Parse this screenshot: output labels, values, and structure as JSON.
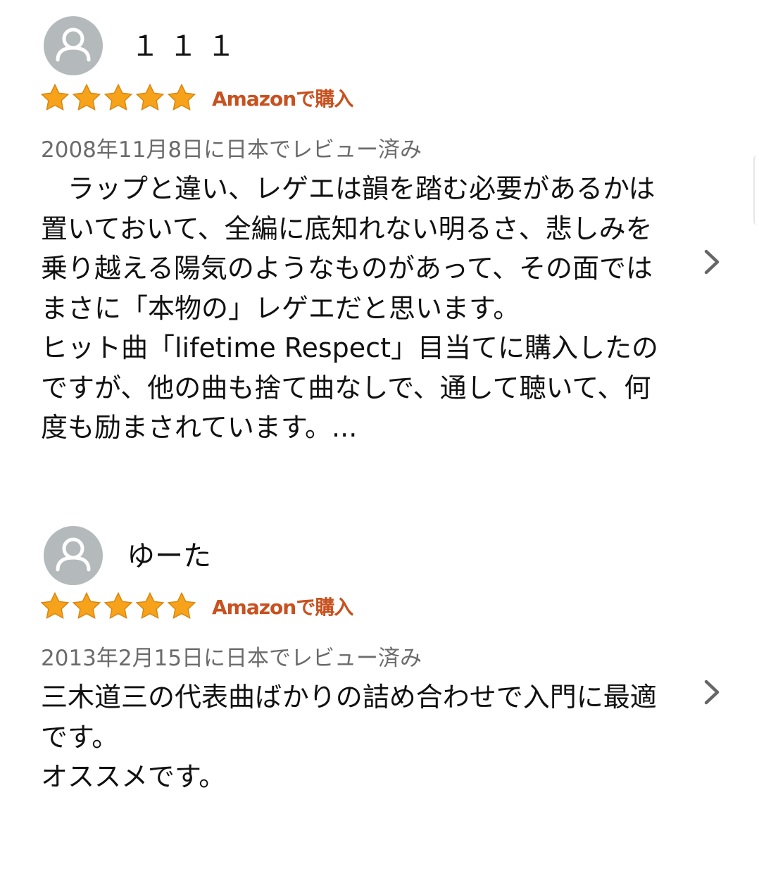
{
  "reviews": [
    {
      "reviewer_name": "１１１",
      "avatar_icon": "user-avatar-icon",
      "rating": 5,
      "rating_max": 5,
      "purchase_badge": "Amazonで購入",
      "date_text": "2008年11月8日に日本でレビュー済み",
      "body": "　ラップと違い、レゲエは韻を踏む必要があるかは置いておいて、全編に底知れない明るさ、悲しみを乗り越える陽気のようなものがあって、その面ではまさに「本物の」レゲエだと思います。\nヒット曲「lifetime Respect」目当てに購入したのですが、他の曲も捨て曲なしで、通して聴いて、何度も励まされています。...",
      "expand_icon": "chevron-right-icon"
    },
    {
      "reviewer_name": "ゆーた",
      "avatar_icon": "user-avatar-icon",
      "rating": 5,
      "rating_max": 5,
      "purchase_badge": "Amazonで購入",
      "date_text": "2013年2月15日に日本でレビュー済み",
      "body": "三木道三の代表曲ばかりの詰め合わせで入門に最適です。\nオススメです。",
      "expand_icon": "chevron-right-icon"
    }
  ],
  "colors": {
    "star": "#f7a21b",
    "star_outline": "#d9860f",
    "badge": "#c7511f",
    "date": "#6b6b6b",
    "avatar_bg": "#b4b9bb",
    "chevron": "#666666"
  }
}
